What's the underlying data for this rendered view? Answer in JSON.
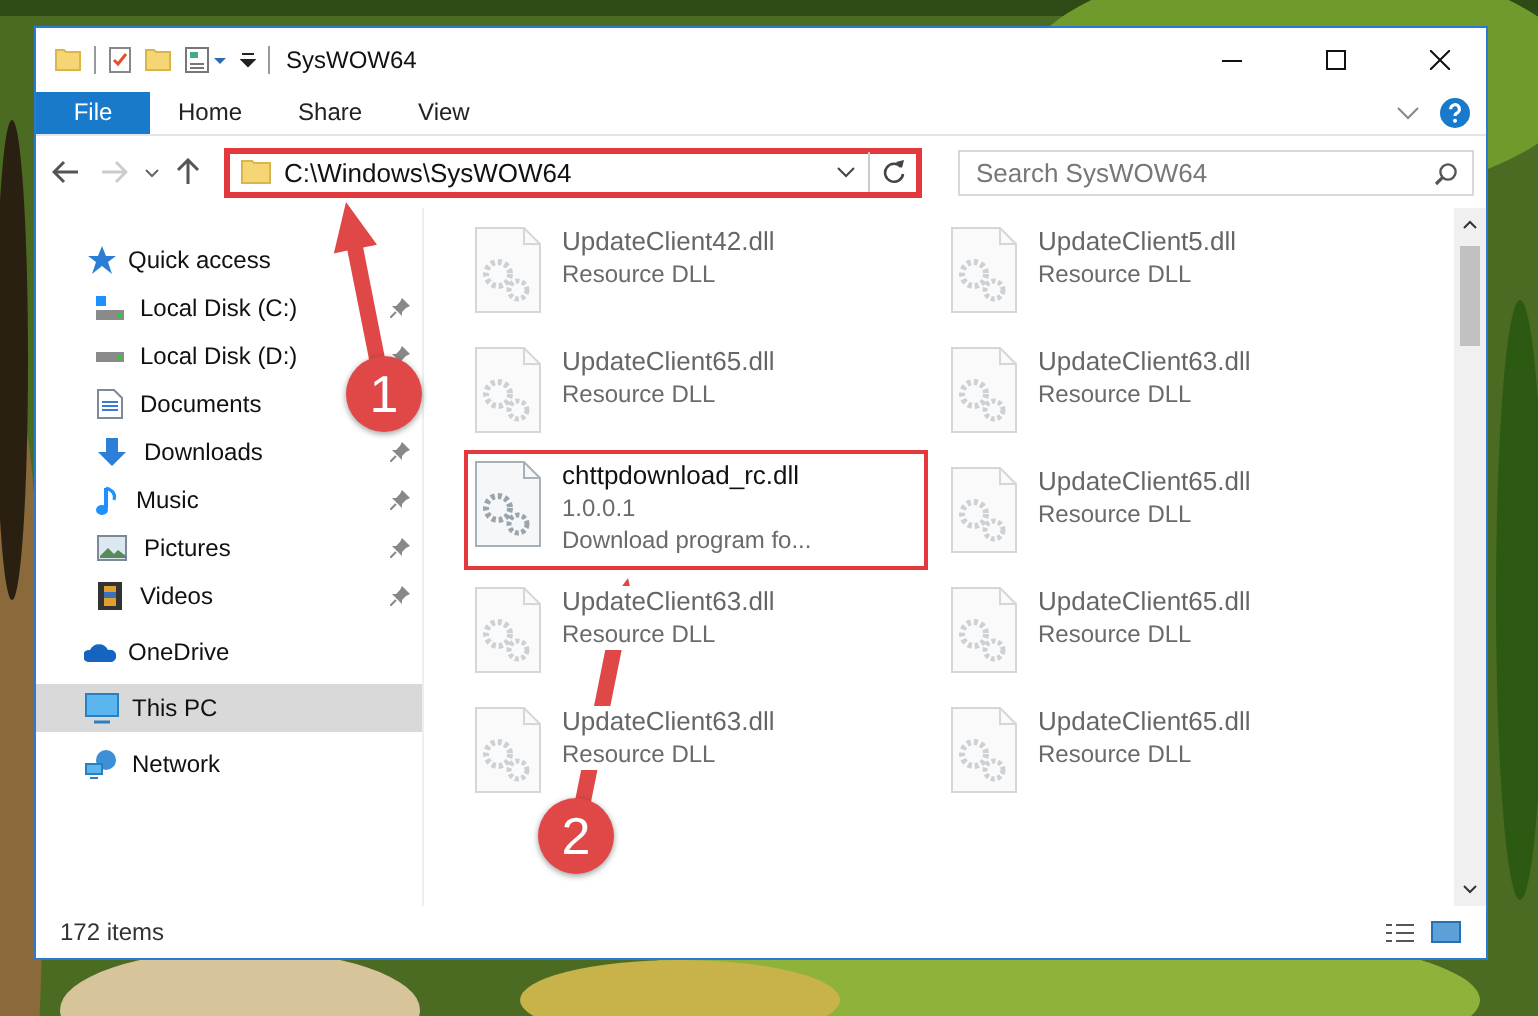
{
  "window": {
    "title": "SysWOW64"
  },
  "ribbon_tabs": [
    {
      "label": "File",
      "kind": "file"
    },
    {
      "label": "Home",
      "kind": "tab"
    },
    {
      "label": "Share",
      "kind": "tab"
    },
    {
      "label": "View",
      "kind": "tab"
    }
  ],
  "address": {
    "path": "C:\\Windows\\SysWOW64",
    "highlighted": true
  },
  "search": {
    "placeholder": "Search SysWOW64"
  },
  "sidebar": [
    {
      "label": "Quick access",
      "kind": "quick",
      "selected": false,
      "children": [
        {
          "label": "Local Disk (C:)",
          "kind": "disk_c",
          "pinned": true
        },
        {
          "label": "Local Disk (D:)",
          "kind": "disk",
          "pinned": true
        },
        {
          "label": "Documents",
          "kind": "documents"
        },
        {
          "label": "Downloads",
          "kind": "downloads",
          "pinned": true
        },
        {
          "label": "Music",
          "kind": "music",
          "pinned": true
        },
        {
          "label": "Pictures",
          "kind": "pictures",
          "pinned": true
        },
        {
          "label": "Videos",
          "kind": "videos",
          "pinned": true
        }
      ]
    },
    {
      "label": "OneDrive",
      "kind": "onedrive",
      "selected": false
    },
    {
      "label": "This PC",
      "kind": "pc",
      "selected": true
    },
    {
      "label": "Network",
      "kind": "network",
      "selected": false
    }
  ],
  "files": [
    {
      "name": "UpdateClient42.dll",
      "line_2": "Resource DLL",
      "blurred": true,
      "highlighted": false
    },
    {
      "name": "UpdateClient5.dll",
      "line_2": "Resource DLL",
      "blurred": true,
      "highlighted": false
    },
    {
      "name": "UpdateClient65.dll",
      "line_2": "Resource DLL",
      "blurred": true,
      "highlighted": false
    },
    {
      "name": "UpdateClient63.dll",
      "line_2": "Resource DLL",
      "blurred": true,
      "highlighted": false
    },
    {
      "name": "chttpdownload_rc.dll",
      "line_2": "1.0.0.1",
      "line_3": "Download program fo...",
      "blurred": false,
      "highlighted": true
    },
    {
      "name": "UpdateClient65.dll",
      "line_2": "Resource DLL",
      "blurred": true,
      "highlighted": false
    },
    {
      "name": "UpdateClient63.dll",
      "line_2": "Resource DLL",
      "blurred": true,
      "highlighted": false
    },
    {
      "name": "UpdateClient65.dll",
      "line_2": "Resource DLL",
      "blurred": true,
      "highlighted": false
    },
    {
      "name": "UpdateClient63.dll",
      "line_2": "Resource DLL",
      "blurred": true,
      "highlighted": false
    },
    {
      "name": "UpdateClient65.dll",
      "line_2": "Resource DLL",
      "blurred": true,
      "highlighted": false
    }
  ],
  "status_bar": {
    "item_count": "172 items"
  },
  "callouts": [
    {
      "number": "1"
    },
    {
      "number": "2"
    }
  ]
}
